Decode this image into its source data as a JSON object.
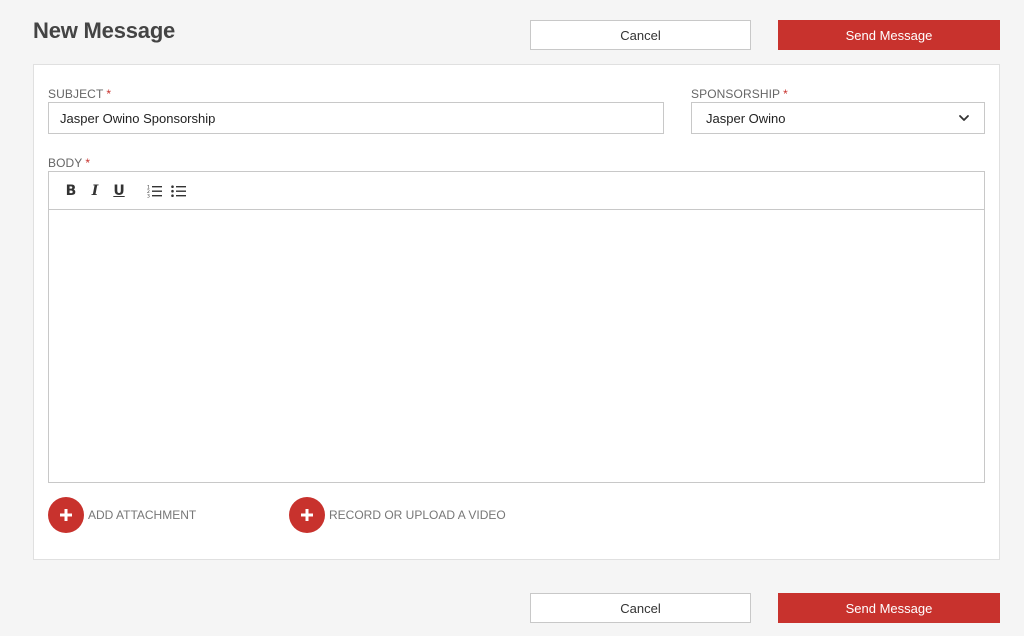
{
  "header": {
    "title": "New Message",
    "cancel_label": "Cancel",
    "send_label": "Send Message"
  },
  "form": {
    "subject": {
      "label": "SUBJECT",
      "required_mark": "*",
      "value": "Jasper Owino Sponsorship"
    },
    "sponsorship": {
      "label": "SPONSORSHIP",
      "required_mark": "*",
      "selected": "Jasper Owino"
    },
    "body": {
      "label": "BODY",
      "required_mark": "*",
      "toolbar": {
        "bold": "B",
        "italic": "I",
        "underline": "U"
      },
      "content": ""
    }
  },
  "attachments": {
    "add_label": "ADD ATTACHMENT",
    "video_label": "RECORD OR UPLOAD A VIDEO"
  },
  "footer": {
    "cancel_label": "Cancel",
    "send_label": "Send Message"
  },
  "colors": {
    "accent": "#c8322d",
    "background": "#f5f5f5",
    "border": "#c8c8c8"
  },
  "icons": {
    "ordered_list": "ordered-list-icon",
    "bullet_list": "bullet-list-icon",
    "chevron": "chevron-down-icon",
    "plus": "plus-icon"
  }
}
